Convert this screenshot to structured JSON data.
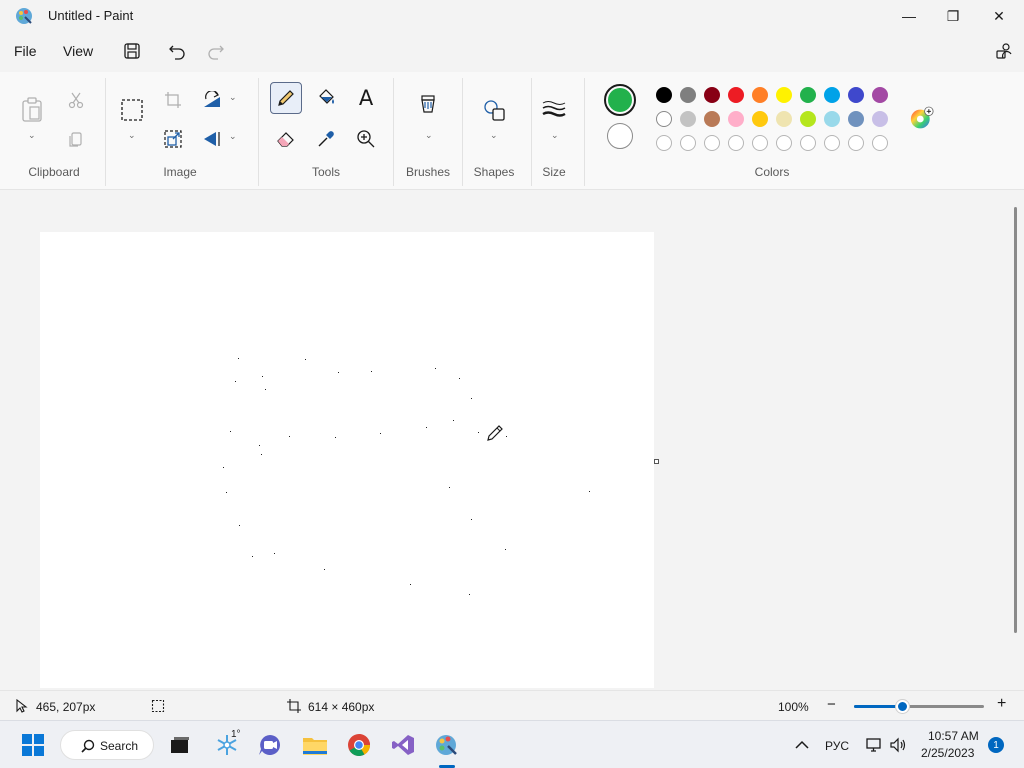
{
  "window": {
    "title": "Untitled - Paint",
    "minimize_glyph": "—",
    "maximize_glyph": "❐",
    "close_glyph": "✕"
  },
  "menu": {
    "file": "File",
    "view": "View"
  },
  "ribbon": {
    "groups": {
      "clipboard": "Clipboard",
      "image": "Image",
      "tools": "Tools",
      "brushes": "Brushes",
      "shapes": "Shapes",
      "size": "Size",
      "colors": "Colors"
    },
    "text_tool_glyph": "A",
    "active_tool": "pencil",
    "color1": "#22b14c",
    "color2": "#ffffff",
    "palette_row1": [
      "#000000",
      "#7f7f7f",
      "#880015",
      "#ed1c24",
      "#ff7f27",
      "#fff200",
      "#22b14c",
      "#00a2e8",
      "#3f48cc",
      "#a349a4"
    ],
    "palette_row2": [
      "#ffffff",
      "#c3c3c3",
      "#b97a57",
      "#ffaec9",
      "#ffc90e",
      "#efe4b0",
      "#b5e61d",
      "#99d9ea",
      "#7092be",
      "#c8bfe7"
    ],
    "palette_row3_empty_count": 10
  },
  "status": {
    "cursor_pos": "465, 207px",
    "canvas_size": "614 × 460px",
    "zoom": "100%",
    "zoom_out": "−",
    "zoom_in": "+",
    "zoom_level": 0.38
  },
  "taskbar": {
    "search_label": "Search",
    "weather_temp": "1°",
    "language": "РУС",
    "time": "10:57 AM",
    "date": "2/25/2023",
    "notification_count": "1"
  }
}
